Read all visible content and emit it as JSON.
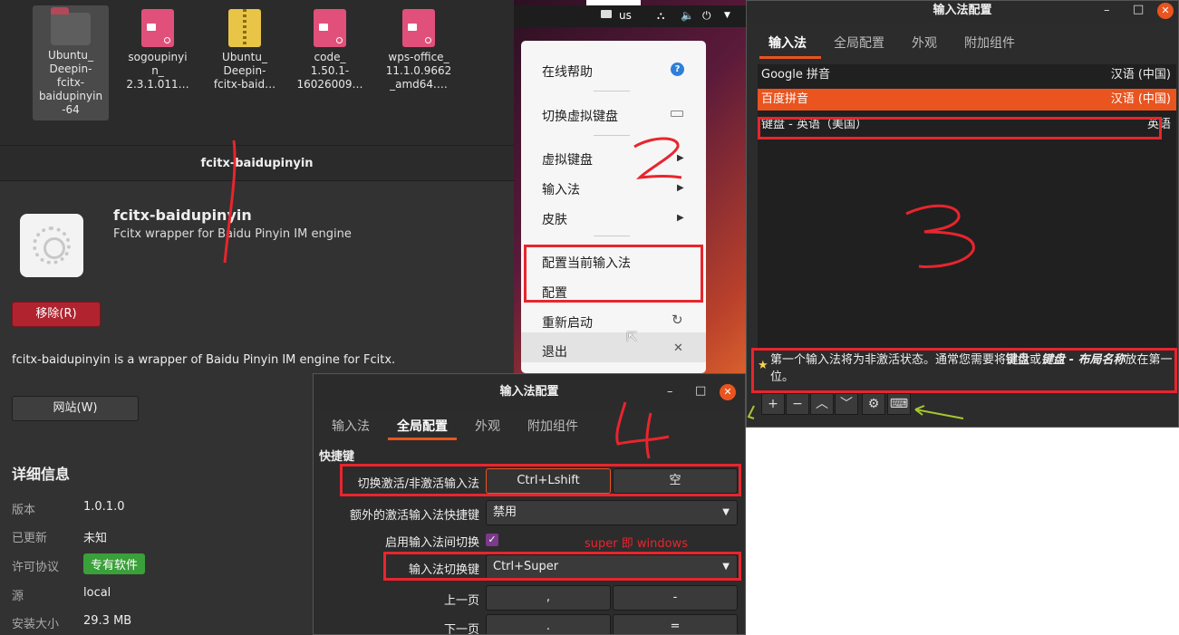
{
  "files": [
    {
      "label": "Ubuntu_\nDeepin-\nfcitx-\nbaidupinyin\n-64",
      "type": "folder",
      "selected": true
    },
    {
      "label": "sogoupinyi\nn_\n2.3.1.011…",
      "type": "deb"
    },
    {
      "label": "Ubuntu_\nDeepin-\nfcitx-baid…",
      "type": "zip"
    },
    {
      "label": "code_\n1.50.1-\n16026009…",
      "type": "deb"
    },
    {
      "label": "wps-office_\n11.1.0.9662\n_amd64.…",
      "type": "deb"
    }
  ],
  "software_center": {
    "header_title": "fcitx-baidupinyin",
    "app_name": "fcitx-baidupinyin",
    "app_summary": "Fcitx wrapper for Baidu Pinyin IM engine",
    "remove_label": "移除(R)",
    "description": "fcitx-baidupinyin is a wrapper of Baidu Pinyin IM engine for Fcitx.",
    "website_label": "网站(W)",
    "details_heading": "详细信息",
    "details": [
      {
        "key": "版本",
        "value": "1.0.1.0"
      },
      {
        "key": "已更新",
        "value": "未知"
      },
      {
        "key": "许可协议",
        "value": "专有软件"
      },
      {
        "key": "源",
        "value": "local"
      },
      {
        "key": "安装大小",
        "value": "29.3 MB"
      }
    ]
  },
  "topbar": {
    "layout": "us"
  },
  "tray_menu": {
    "items": [
      "在线帮助",
      "切换虚拟键盘",
      "虚拟键盘",
      "输入法",
      "皮肤",
      "配置当前输入法",
      "配置",
      "重新启动",
      "退出"
    ]
  },
  "im_config_window": {
    "title": "输入法配置",
    "tabs": [
      "输入法",
      "全局配置",
      "外观",
      "附加组件"
    ],
    "input_methods": [
      {
        "name": "Google 拼音",
        "lang": "汉语 (中国)"
      },
      {
        "name": "百度拼音",
        "lang": "汉语 (中国)",
        "selected": true
      },
      {
        "name": "键盘 - 英语（美国）",
        "lang": "英语"
      }
    ],
    "hint_part1": "第一个输入法将为非激活状态。通常您需要将",
    "hint_bold1": "键盘",
    "hint_part2": "或",
    "hint_bold2": "键盘 - 布局名称",
    "hint_part3": "放在第一位。",
    "toolbar": [
      "+",
      "−",
      "︿",
      "﹀",
      "⚙",
      "⌨"
    ]
  },
  "global_config_window": {
    "title": "输入法配置",
    "tabs": [
      "输入法",
      "全局配置",
      "外观",
      "附加组件"
    ],
    "section": "快捷键",
    "rows": [
      {
        "label": "切换激活/非激活输入法",
        "key1": "Ctrl+Lshift",
        "key2": "空"
      },
      {
        "label": "额外的激活输入法快捷键",
        "combo": "禁用"
      },
      {
        "label": "启用输入法间切换",
        "checked": true
      },
      {
        "label": "输入法切换键",
        "combo": "Ctrl+Super"
      },
      {
        "label": "上一页",
        "key1": ",",
        "key2": "-"
      },
      {
        "label": "下一页",
        "key1": ".",
        "key2": "="
      }
    ],
    "note": "super 即 windows"
  },
  "annotations": [
    "2",
    "3",
    "4"
  ],
  "colors": {
    "accent": "#e9541f",
    "annotation": "#e8252d",
    "remove": "#b0232f",
    "license": "#3aa03a"
  }
}
